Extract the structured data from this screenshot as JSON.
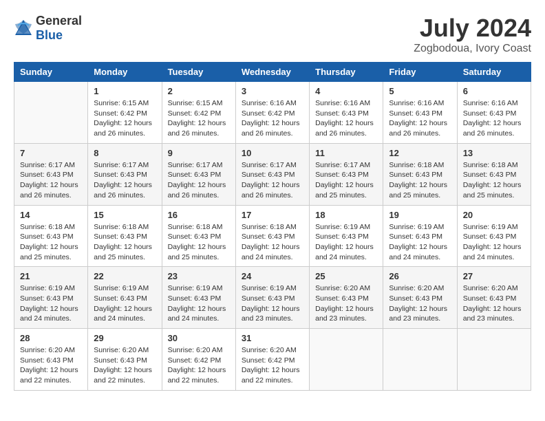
{
  "header": {
    "logo_general": "General",
    "logo_blue": "Blue",
    "title": "July 2024",
    "subtitle": "Zogbodoua, Ivory Coast"
  },
  "calendar": {
    "days_of_week": [
      "Sunday",
      "Monday",
      "Tuesday",
      "Wednesday",
      "Thursday",
      "Friday",
      "Saturday"
    ],
    "weeks": [
      [
        {
          "day": "",
          "content": ""
        },
        {
          "day": "1",
          "content": "Sunrise: 6:15 AM\nSunset: 6:42 PM\nDaylight: 12 hours\nand 26 minutes."
        },
        {
          "day": "2",
          "content": "Sunrise: 6:15 AM\nSunset: 6:42 PM\nDaylight: 12 hours\nand 26 minutes."
        },
        {
          "day": "3",
          "content": "Sunrise: 6:16 AM\nSunset: 6:42 PM\nDaylight: 12 hours\nand 26 minutes."
        },
        {
          "day": "4",
          "content": "Sunrise: 6:16 AM\nSunset: 6:43 PM\nDaylight: 12 hours\nand 26 minutes."
        },
        {
          "day": "5",
          "content": "Sunrise: 6:16 AM\nSunset: 6:43 PM\nDaylight: 12 hours\nand 26 minutes."
        },
        {
          "day": "6",
          "content": "Sunrise: 6:16 AM\nSunset: 6:43 PM\nDaylight: 12 hours\nand 26 minutes."
        }
      ],
      [
        {
          "day": "7",
          "content": "Sunrise: 6:17 AM\nSunset: 6:43 PM\nDaylight: 12 hours\nand 26 minutes."
        },
        {
          "day": "8",
          "content": "Sunrise: 6:17 AM\nSunset: 6:43 PM\nDaylight: 12 hours\nand 26 minutes."
        },
        {
          "day": "9",
          "content": "Sunrise: 6:17 AM\nSunset: 6:43 PM\nDaylight: 12 hours\nand 26 minutes."
        },
        {
          "day": "10",
          "content": "Sunrise: 6:17 AM\nSunset: 6:43 PM\nDaylight: 12 hours\nand 26 minutes."
        },
        {
          "day": "11",
          "content": "Sunrise: 6:17 AM\nSunset: 6:43 PM\nDaylight: 12 hours\nand 25 minutes."
        },
        {
          "day": "12",
          "content": "Sunrise: 6:18 AM\nSunset: 6:43 PM\nDaylight: 12 hours\nand 25 minutes."
        },
        {
          "day": "13",
          "content": "Sunrise: 6:18 AM\nSunset: 6:43 PM\nDaylight: 12 hours\nand 25 minutes."
        }
      ],
      [
        {
          "day": "14",
          "content": "Sunrise: 6:18 AM\nSunset: 6:43 PM\nDaylight: 12 hours\nand 25 minutes."
        },
        {
          "day": "15",
          "content": "Sunrise: 6:18 AM\nSunset: 6:43 PM\nDaylight: 12 hours\nand 25 minutes."
        },
        {
          "day": "16",
          "content": "Sunrise: 6:18 AM\nSunset: 6:43 PM\nDaylight: 12 hours\nand 25 minutes."
        },
        {
          "day": "17",
          "content": "Sunrise: 6:18 AM\nSunset: 6:43 PM\nDaylight: 12 hours\nand 24 minutes."
        },
        {
          "day": "18",
          "content": "Sunrise: 6:19 AM\nSunset: 6:43 PM\nDaylight: 12 hours\nand 24 minutes."
        },
        {
          "day": "19",
          "content": "Sunrise: 6:19 AM\nSunset: 6:43 PM\nDaylight: 12 hours\nand 24 minutes."
        },
        {
          "day": "20",
          "content": "Sunrise: 6:19 AM\nSunset: 6:43 PM\nDaylight: 12 hours\nand 24 minutes."
        }
      ],
      [
        {
          "day": "21",
          "content": "Sunrise: 6:19 AM\nSunset: 6:43 PM\nDaylight: 12 hours\nand 24 minutes."
        },
        {
          "day": "22",
          "content": "Sunrise: 6:19 AM\nSunset: 6:43 PM\nDaylight: 12 hours\nand 24 minutes."
        },
        {
          "day": "23",
          "content": "Sunrise: 6:19 AM\nSunset: 6:43 PM\nDaylight: 12 hours\nand 24 minutes."
        },
        {
          "day": "24",
          "content": "Sunrise: 6:19 AM\nSunset: 6:43 PM\nDaylight: 12 hours\nand 23 minutes."
        },
        {
          "day": "25",
          "content": "Sunrise: 6:20 AM\nSunset: 6:43 PM\nDaylight: 12 hours\nand 23 minutes."
        },
        {
          "day": "26",
          "content": "Sunrise: 6:20 AM\nSunset: 6:43 PM\nDaylight: 12 hours\nand 23 minutes."
        },
        {
          "day": "27",
          "content": "Sunrise: 6:20 AM\nSunset: 6:43 PM\nDaylight: 12 hours\nand 23 minutes."
        }
      ],
      [
        {
          "day": "28",
          "content": "Sunrise: 6:20 AM\nSunset: 6:43 PM\nDaylight: 12 hours\nand 22 minutes."
        },
        {
          "day": "29",
          "content": "Sunrise: 6:20 AM\nSunset: 6:43 PM\nDaylight: 12 hours\nand 22 minutes."
        },
        {
          "day": "30",
          "content": "Sunrise: 6:20 AM\nSunset: 6:42 PM\nDaylight: 12 hours\nand 22 minutes."
        },
        {
          "day": "31",
          "content": "Sunrise: 6:20 AM\nSunset: 6:42 PM\nDaylight: 12 hours\nand 22 minutes."
        },
        {
          "day": "",
          "content": ""
        },
        {
          "day": "",
          "content": ""
        },
        {
          "day": "",
          "content": ""
        }
      ]
    ]
  }
}
